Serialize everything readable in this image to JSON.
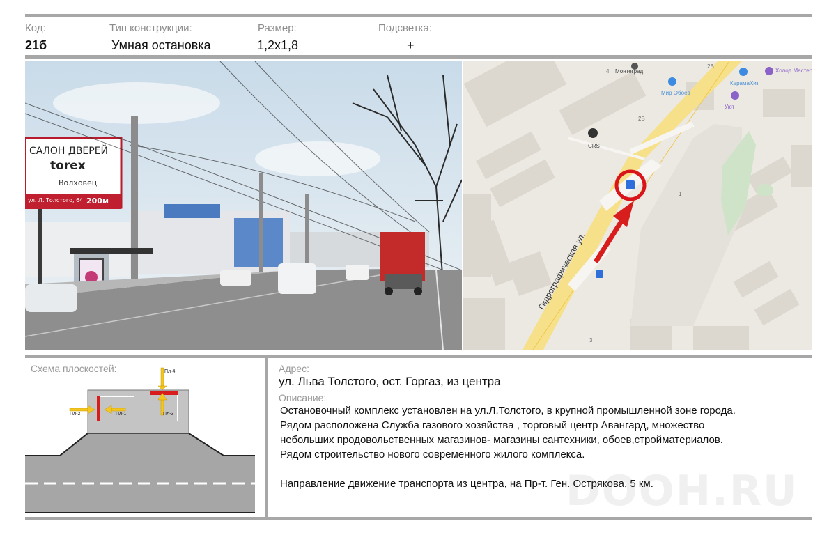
{
  "header": {
    "code_label": "Код:",
    "code_value": "21б",
    "type_label": "Тип конструкции:",
    "type_value": "Умная остановка",
    "size_label": "Размер:",
    "size_value": "1,2х1,8",
    "light_label": "Подсветка:",
    "light_value": "+"
  },
  "photo": {
    "billboard_line1": "САЛОН ДВЕРЕЙ",
    "billboard_line2": "torex",
    "billboard_line3": "Волховец",
    "billboard_addr": "ул. Л. Толстого, 64",
    "billboard_dist": "200м"
  },
  "map": {
    "labels": {
      "n4": "4",
      "montegrad": "Монтеград",
      "n2v": "2В",
      "mir_oboev": "Мир Обоев",
      "keramahit": "КерамаХит",
      "holod": "Холод Мастер",
      "uyut": "Уют",
      "n2b": "2Б",
      "crs": "CRS",
      "n1": "1",
      "n3": "3",
      "street": "Гидрографическая ул."
    }
  },
  "scheme": {
    "title": "Схема плоскостей:",
    "pl1": "Пл-1",
    "pl2": "Пл-2",
    "pl3": "Пл-3",
    "pl4": "Пл-4"
  },
  "address": {
    "label": "Адрес:",
    "value": "ул. Льва Толстого, ост. Горгаз, из центра"
  },
  "description": {
    "label": "Описание:",
    "lines": [
      "Остановочный комплекс установлен на ул.Л.Толстого, в крупной промышленной зоне города.",
      "Рядом расположена Служба газового хозяйства , торговый центр Авангард,  множество",
      "небольших продовольственных магазинов- магазины сантехники, обоев,стройматериалов.",
      "Рядом  строительство нового  современного  жилого комплекса."
    ],
    "direction": "Направление движение транспорта из центра, на Пр-т. Ген. Острякова, 5 км."
  },
  "watermark": "DOOH.RU"
}
